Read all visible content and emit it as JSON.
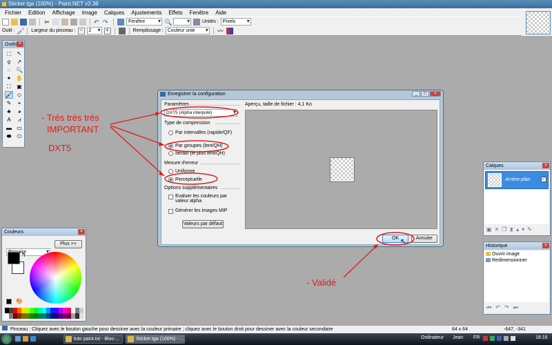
{
  "window": {
    "title": "Sticker.tga (100%) - Paint.NET v3.36"
  },
  "menu": [
    "Fichier",
    "Edition",
    "Affichage",
    "Image",
    "Calques",
    "Ajustements",
    "Effets",
    "Fenêtre",
    "Aide"
  ],
  "toolbar1": {
    "window_combo": "Fenêtre",
    "units_label": "Unités :",
    "units_value": "Pixels"
  },
  "toolbar2": {
    "tool_label": "Outil :",
    "brush_label": "Largeur du pinceau :",
    "brush_value": "2",
    "fill_label": "Remplissage :",
    "fill_value": "Couleur unie"
  },
  "tools_panel": {
    "title": "Outils"
  },
  "colors_panel": {
    "title": "Couleurs",
    "mode": "Primaire",
    "more_button": "Plus >>"
  },
  "layers_panel": {
    "title": "Calques",
    "layer_name": "Arrière-plan"
  },
  "history_panel": {
    "title": "Historique",
    "items": [
      "Ouvrir image",
      "Redimensionner"
    ]
  },
  "dialog": {
    "title": "Enregistrer la configuration",
    "params_label": "Paramètres",
    "format_value": "DXT5 (Alpha interpolé)",
    "compression_label": "Type de compression",
    "compression_options": [
      "Par intervalles (rapide/QF)",
      "Par groupes (lent/QH)",
      "Itératif (le plus lent/QH)"
    ],
    "error_label": "Mesure d'erreur",
    "error_options": [
      "Uniforme",
      "Perceptuelle"
    ],
    "extra_label": "Options supplémentaires",
    "extra_options": [
      "Evaluer les couleurs par valeur alpha",
      "Générer les images MIP"
    ],
    "defaults_button": "Valeurs par défaut",
    "preview_label": "Aperçu, taille de fichier : 4,1 Ko",
    "ok_button": "OK",
    "cancel_button": "Annuler"
  },
  "annotations": {
    "line1": "- Trés trés trés",
    "line2": "IMPORTANT",
    "line3": "DXT5",
    "validated": "- Validé"
  },
  "status": {
    "hint": "Pinceau : Cliquez avec le bouton gauche pour dessiner avec la couleur primaire ; cliquez avec le bouton droit pour dessiner avec la couleur secondaire",
    "size": "64 x 64",
    "coords": "-647, -341"
  },
  "taskbar": {
    "tasks": [
      "tuto paint.txt - Bloc-...",
      "Sticker.tga (100%) - ..."
    ],
    "computer": "Ordinateur",
    "user": "Jean",
    "lang": "FR",
    "time": "18:16"
  }
}
